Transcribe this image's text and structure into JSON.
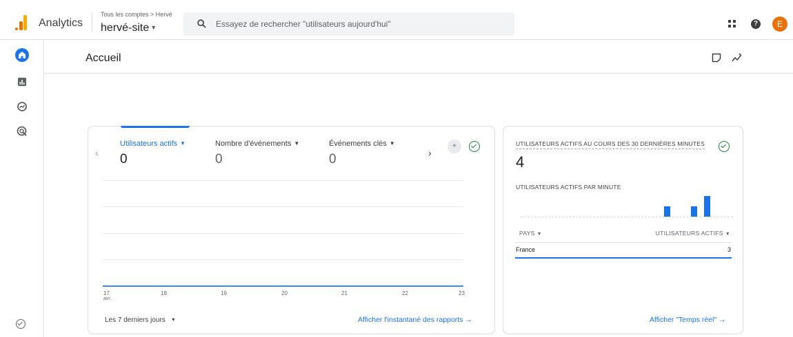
{
  "app": {
    "name": "Analytics"
  },
  "header": {
    "breadcrumb": "Tous les comptes > Hervé",
    "property": "hervé-site",
    "search_placeholder": "Essayez de rechercher \"utilisateurs aujourd'hui\"",
    "avatar_letter": "E"
  },
  "page": {
    "title": "Accueil"
  },
  "overview_card": {
    "metrics": [
      {
        "label": "Utilisateurs actifs",
        "value": "0",
        "selected": true
      },
      {
        "label": "Nombre d'événements",
        "value": "0",
        "selected": false
      },
      {
        "label": "Événements clés",
        "value": "0",
        "selected": false
      }
    ],
    "x_ticks": [
      "17",
      "18",
      "19",
      "20",
      "21",
      "22",
      "23"
    ],
    "x_sub": "avr.",
    "date_range": "Les 7 derniers jours",
    "link": "Afficher l'instantané des rapports"
  },
  "realtime_card": {
    "title": "UTILISATEURS ACTIFS AU COURS DES 30 DERNIÈRES MINUTES",
    "value": "4",
    "per_minute_label": "UTILISATEURS ACTIFS PAR MINUTE",
    "bar_values": [
      1,
      1,
      2
    ],
    "col_country": "PAYS",
    "col_users": "UTILISATEURS ACTIFS",
    "rows": [
      {
        "country": "France",
        "users": "3"
      }
    ],
    "link": "Afficher \"Temps réel\""
  },
  "colors": {
    "accent": "#1a73e8",
    "success": "#188038",
    "avatar": "#e8710a",
    "logo_dark": "#e37400",
    "logo_light": "#f9ab00"
  }
}
